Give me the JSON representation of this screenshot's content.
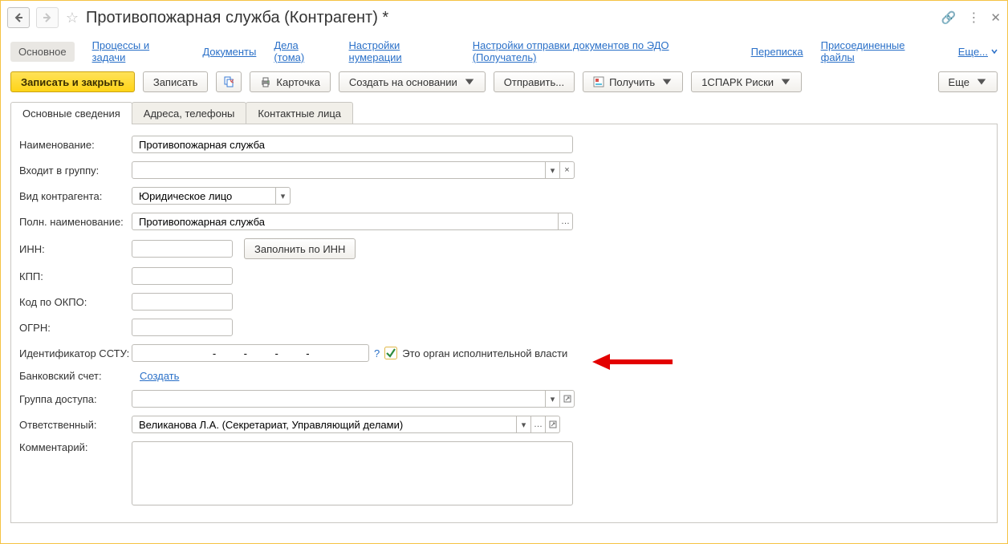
{
  "title": "Противопожарная служба (Контрагент) *",
  "nav": [
    "Основное",
    "Процессы и задачи",
    "Документы",
    "Дела (тома)",
    "Настройки нумерации",
    "Настройки отправки документов по ЭДО (Получатель)",
    "Переписка",
    "Присоединенные файлы",
    "Еще..."
  ],
  "toolbar": {
    "save_close": "Записать и закрыть",
    "save": "Записать",
    "card": "Карточка",
    "create_based": "Создать на основании",
    "send": "Отправить...",
    "receive": "Получить",
    "spark": "1СПАРК Риски",
    "more": "Еще"
  },
  "tabs": [
    "Основные сведения",
    "Адреса, телефоны",
    "Контактные лица"
  ],
  "labels": {
    "name": "Наименование:",
    "group": "Входит в группу:",
    "kind": "Вид контрагента:",
    "full": "Полн. наименование:",
    "inn": "ИНН:",
    "fill_inn": "Заполнить по ИНН",
    "kpp": "КПП:",
    "okpo": "Код по ОКПО:",
    "ogrn": "ОГРН:",
    "ssid": "Идентификатор ССТУ:",
    "exec_auth": "Это орган исполнительной власти",
    "bank": "Банковский счет:",
    "create": "Создать",
    "access": "Группа доступа:",
    "resp": "Ответственный:",
    "comment": "Комментарий:"
  },
  "values": {
    "name": "Противопожарная служба",
    "group": "",
    "kind": "Юридическое лицо",
    "full": "Противопожарная служба",
    "inn": "",
    "kpp": "",
    "okpo": "",
    "ogrn": "",
    "ssid": "    -    -    -    -",
    "exec_auth_checked": true,
    "access": "",
    "resp": "Великанова Л.А. (Секретариат, Управляющий делами)",
    "comment": ""
  }
}
